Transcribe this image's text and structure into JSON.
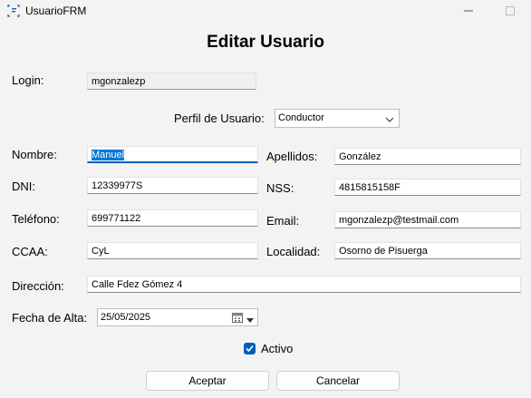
{
  "window": {
    "title": "UsuarioFRM",
    "icon": "form-app-icon"
  },
  "form": {
    "title": "Editar Usuario"
  },
  "fields": {
    "login": {
      "label": "Login:",
      "value": "mgonzalezp"
    },
    "perfil": {
      "label": "Perfil de Usuario:",
      "value": "Conductor"
    },
    "nombre": {
      "label": "Nombre:",
      "value": "Manuel"
    },
    "apellidos": {
      "label": "Apellidos:",
      "value": "González"
    },
    "dni": {
      "label": "DNI:",
      "value": "12339977S"
    },
    "nss": {
      "label": "NSS:",
      "value": "4815815158F"
    },
    "telefono": {
      "label": "Teléfono:",
      "value": "699771122"
    },
    "email": {
      "label": "Email:",
      "value": "mgonzalezp@testmail.com"
    },
    "ccaa": {
      "label": "CCAA:",
      "value": "CyL"
    },
    "localidad": {
      "label": "Localidad:",
      "value": "Osorno de Pisuerga"
    },
    "direccion": {
      "label": "Dirección:",
      "value": "Calle Fdez Gómez 4"
    },
    "fecha_alta": {
      "label": "Fecha de Alta:",
      "value": "25/05/2025"
    }
  },
  "activo": {
    "label": "Activo",
    "checked": true
  },
  "buttons": {
    "accept": "Aceptar",
    "cancel": "Cancelar"
  },
  "colors": {
    "accent": "#005fb8",
    "background": "#f3f3f3",
    "selection": "#0078d7"
  }
}
